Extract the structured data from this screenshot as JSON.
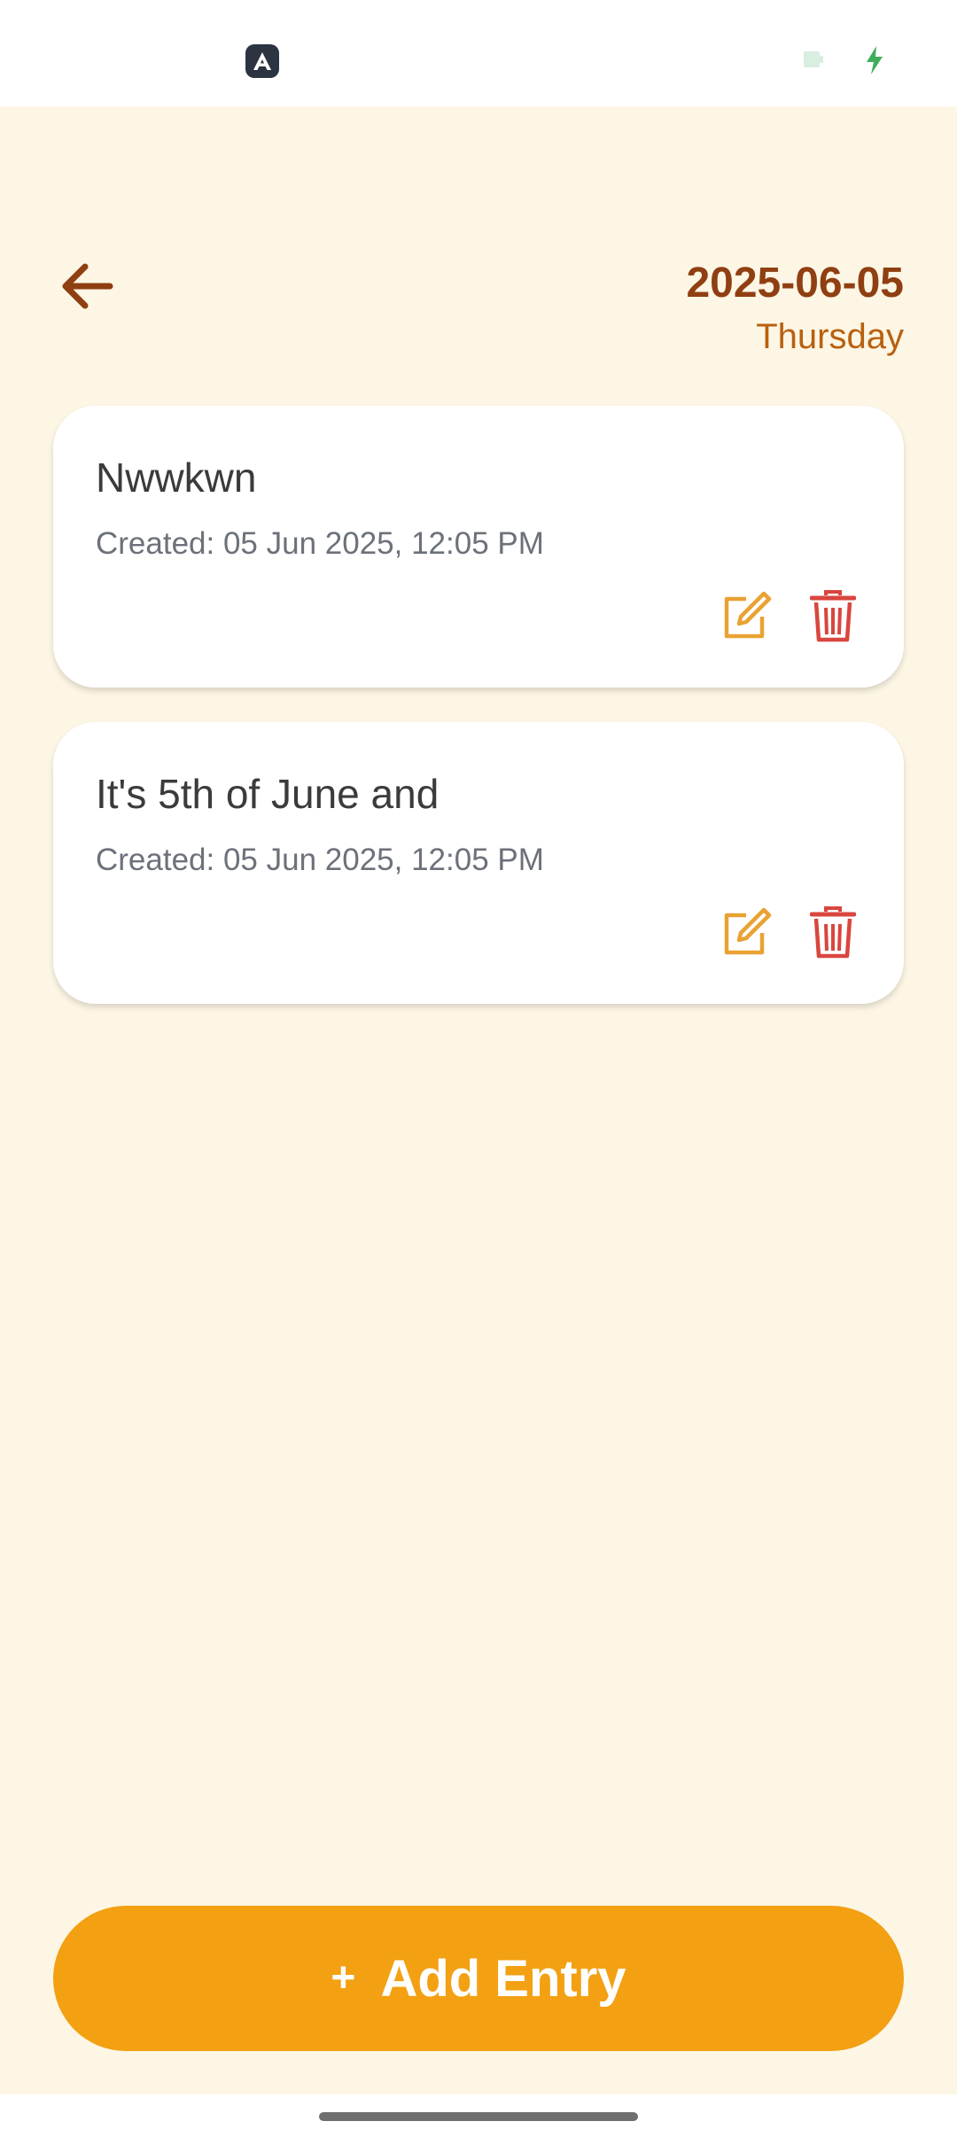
{
  "status_bar": {
    "icons": [
      "app-logo-icon",
      "battery-icon",
      "charging-bolt-icon"
    ]
  },
  "header": {
    "date": "2025-06-05",
    "weekday": "Thursday",
    "back_icon": "arrow-left-icon"
  },
  "entries": [
    {
      "title": "Nwwkwn",
      "created": "Created: 05 Jun 2025, 12:05 PM"
    },
    {
      "title": "It's 5th of June and",
      "created": "Created: 05 Jun 2025, 12:05 PM"
    }
  ],
  "add_entry": {
    "icon": "+",
    "label": "Add Entry"
  },
  "colors": {
    "background": "#fdf6e5",
    "accent": "#f3a012",
    "header_date": "#8f3f11",
    "weekday": "#b9600f",
    "edit_icon": "#e9a233",
    "delete_icon": "#d9463e"
  }
}
